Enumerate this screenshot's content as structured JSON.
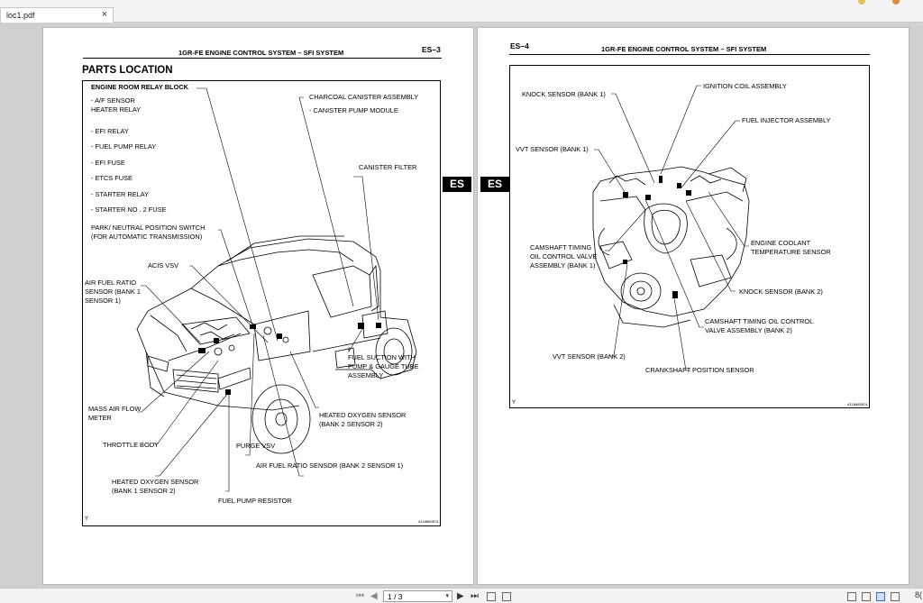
{
  "tab": {
    "title": "loc1.pdf",
    "close": "×"
  },
  "pages": {
    "left": {
      "header_title": "1GR-FE ENGINE CONTROL SYSTEM  –  SFI SYSTEM",
      "page_code": "ES–3",
      "section_title": "PARTS LOCATION",
      "labels": {
        "relay_block": "ENGINE ROOM RELAY BLOCK",
        "af_relay": "- A/F SENSOR",
        "af_relay2": "HEATER RELAY",
        "efi_relay": "- EFI RELAY",
        "fuel_pump_relay": "- FUEL PUMP RELAY",
        "efi_fuse": "- EFI FUSE",
        "etcs_fuse": "- ETCS FUSE",
        "starter_relay": "- STARTER RELAY",
        "starter2_fuse": "- STARTER NO . 2 FUSE",
        "park_neutral": "PARK/ NEUTRAL POSITION SWITCH",
        "park_neutral2": "(FOR AUTOMATIC TRANSMISSION)",
        "acis": "ACIS VSV",
        "af_sensor_b1": "AIR FUEL RATIO",
        "af_sensor_b1_2": "SENSOR (BANK 1",
        "af_sensor_b1_3": "SENSOR 1)",
        "maf": "MASS AIR FLOW",
        "maf2": "METER",
        "throttle": "THROTTLE BODY",
        "ho2_b1s2": "HEATED OXYGEN SENSOR",
        "ho2_b1s2_2": "(BANK 1 SENSOR 2)",
        "fuel_pump_resistor": "FUEL PUMP RESISTOR",
        "purge_vsv": "PURGE VSV",
        "af_sensor_b2": "AIR FUEL RATIO SENSOR (BANK 2 SENSOR 1)",
        "ho2_b2s2": "HEATED OXYGEN SENSOR",
        "ho2_b2s2_2": "(BANK 2 SENSOR 2)",
        "fuel_suction": "FUEL SUCTION WITH",
        "fuel_suction2": "PUMP & GAUGE TUBE",
        "fuel_suction3": "ASSEMBLY",
        "charcoal": "CHARCOAL CANISTER ASSEMBLY",
        "canister_pump": "- CANISTER PUMP MODULE",
        "canister_filter": "CANISTER FILTER",
        "corner_y": "Y",
        "art_id": "A118680E01"
      }
    },
    "right": {
      "page_code": "ES–4",
      "header_title": "1GR-FE ENGINE CONTROL SYSTEM  –  SFI SYSTEM",
      "labels": {
        "knock_b1": "KNOCK SENSOR (BANK 1)",
        "ignition_coil": "IGNITION COIL ASSEMBLY",
        "injector": "FUEL INJECTOR ASSEMBLY",
        "vvt_b1": "VVT SENSOR (BANK 1)",
        "cam_ocv_b1": "CAMSHAFT TIMING",
        "cam_ocv_b1_2": "OIL CONTROL VALVE",
        "cam_ocv_b1_3": "ASSEMBLY (BANK 1)",
        "coolant": "ENGINE COOLANT",
        "coolant2": "TEMPERATURE SENSOR",
        "knock_b2": "KNOCK SENSOR (BANK 2)",
        "cam_ocv_b2": "CAMSHAFT TIMING OIL CONTROL",
        "cam_ocv_b2_2": "VALVE ASSEMBLY (BANK 2)",
        "vvt_b2": "VVT SENSOR (BANK 2)",
        "crank": "CRANKSHAFT POSITION SENSOR",
        "corner_y": "Y",
        "art_id": "A118685E01"
      }
    }
  },
  "side_tabs": {
    "left": "ES",
    "right": "ES"
  },
  "toolbar": {
    "first": "⏮",
    "prev": "◀",
    "page_value": "1 / 3",
    "page_caret": "▾",
    "next": "▶",
    "last": "⏭",
    "zoom": "8("
  },
  "colors": {
    "viewer_bg": "#d0d0d0",
    "page_bg": "#ffffff",
    "ink": "#000000"
  }
}
